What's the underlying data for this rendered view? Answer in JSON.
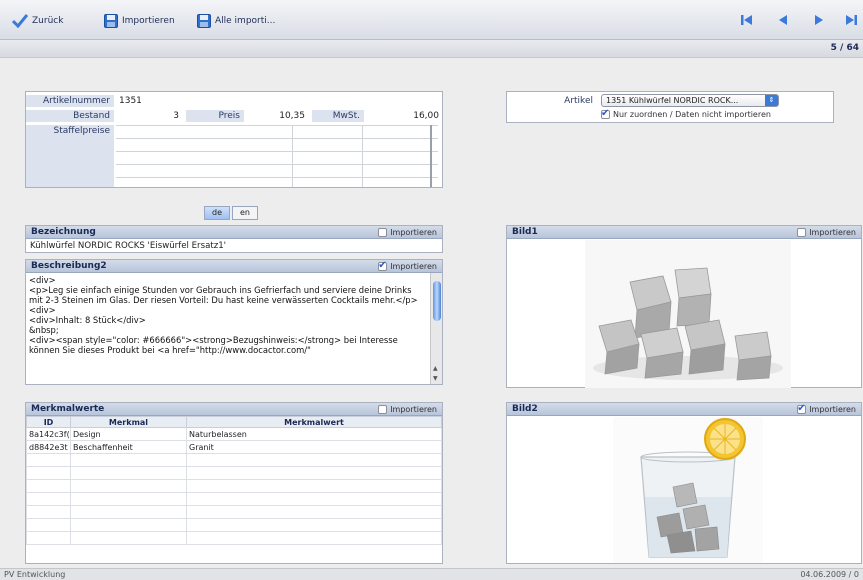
{
  "toolbar": {
    "back_label": "Zurück",
    "import_label": "Importieren",
    "import_all_label": "Alle importi..."
  },
  "pager": "5 / 64",
  "article": {
    "artikelnummer_label": "Artikelnummer",
    "artikelnummer": "1351",
    "bestand_label": "Bestand",
    "bestand": "3",
    "preis_label": "Preis",
    "preis": "10,35",
    "mwst_label": "MwSt.",
    "mwst": "16,00",
    "staffelpreise_label": "Staffelpreise"
  },
  "match": {
    "artikel_label": "Artikel",
    "artikel_selected": "1351 Kühlwürfel NORDIC ROCK...",
    "only_assign_label": "Nur zuordnen / Daten nicht importieren",
    "only_assign_checked": true
  },
  "languages": [
    "de",
    "en"
  ],
  "bezeichnung": {
    "title": "Bezeichnung",
    "import_label": "Importieren",
    "import_checked": false,
    "value": "Kühlwürfel NORDIC ROCKS 'Eiswürfel Ersatz1'"
  },
  "beschreibung": {
    "title": "Beschreibung2",
    "import_label": "Importieren",
    "import_checked": true,
    "text": "<div>\n<p>Leg sie einfach einige Stunden vor Gebrauch ins Gefrierfach und serviere deine Drinks mit 2-3 Steinen im Glas. Der riesen Vorteil: Du hast keine verwässerten Cocktails mehr.</p>\n<div>\n<div>Inhalt: 8 Stück</div>\n&nbsp;\n<div><span style=\"color: #666666\"><strong>Bezugshinweis:</strong> bei Interesse können Sie dieses Produkt bei <a href=\"http://www.docactor.com/\""
  },
  "merkmale": {
    "title": "Merkmalwerte",
    "import_label": "Importieren",
    "import_checked": false,
    "columns": [
      "ID",
      "Merkmal",
      "Merkmalwert"
    ],
    "rows": [
      [
        "8a142c3f(",
        "Design",
        "Naturbelassen"
      ],
      [
        "d8842e3t",
        "Beschaffenheit",
        "Granit"
      ]
    ]
  },
  "bild1": {
    "title": "Bild1",
    "import_label": "Importieren",
    "import_checked": false
  },
  "bild2": {
    "title": "Bild2",
    "import_label": "Importieren",
    "import_checked": true
  },
  "status": {
    "left": "PV Entwicklung",
    "right": "04.06.2009 / 0"
  }
}
